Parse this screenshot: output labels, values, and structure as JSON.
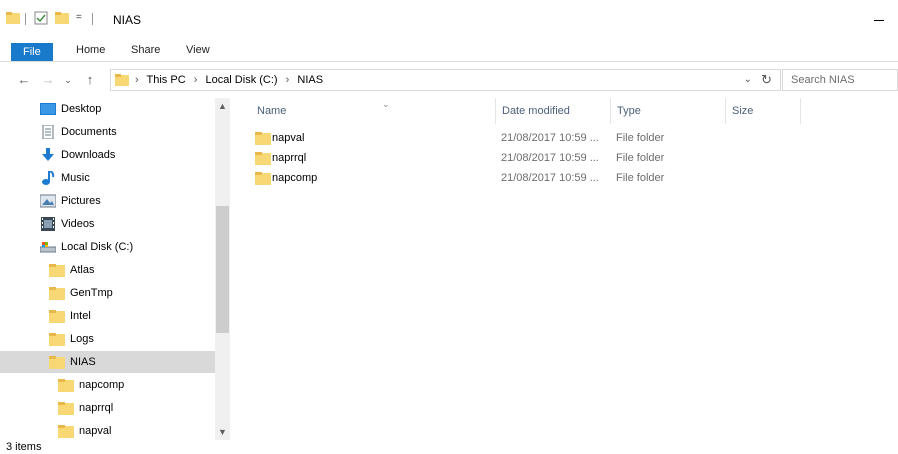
{
  "window": {
    "title": "NIAS"
  },
  "ribbon": {
    "tabs": [
      {
        "label": "File"
      },
      {
        "label": "Home"
      },
      {
        "label": "Share"
      },
      {
        "label": "View"
      }
    ]
  },
  "address": {
    "crumbs": [
      "This PC",
      "Local Disk (C:)",
      "NIAS"
    ],
    "separator": "›"
  },
  "search": {
    "placeholder": "Search NIAS"
  },
  "nav_tree": {
    "items": [
      {
        "label": "Desktop",
        "icon": "desktop-icon"
      },
      {
        "label": "Documents",
        "icon": "documents-icon"
      },
      {
        "label": "Downloads",
        "icon": "downloads-icon"
      },
      {
        "label": "Music",
        "icon": "music-icon"
      },
      {
        "label": "Pictures",
        "icon": "pictures-icon"
      },
      {
        "label": "Videos",
        "icon": "videos-icon"
      },
      {
        "label": "Local Disk (C:)",
        "icon": "drive-icon"
      },
      {
        "label": "Atlas",
        "icon": "folder-icon"
      },
      {
        "label": "GenTmp",
        "icon": "folder-icon"
      },
      {
        "label": "Intel",
        "icon": "folder-icon"
      },
      {
        "label": "Logs",
        "icon": "folder-icon"
      },
      {
        "label": "NIAS",
        "icon": "folder-icon",
        "selected": true
      },
      {
        "label": "napcomp",
        "icon": "folder-icon"
      },
      {
        "label": "naprrql",
        "icon": "folder-icon"
      },
      {
        "label": "napval",
        "icon": "folder-icon"
      }
    ]
  },
  "columns": {
    "name": "Name",
    "date": "Date modified",
    "type": "Type",
    "size": "Size"
  },
  "files": [
    {
      "name": "napval",
      "date": "21/08/2017 10:59 ...",
      "type": "File folder"
    },
    {
      "name": "naprrql",
      "date": "21/08/2017 10:59 ...",
      "type": "File folder"
    },
    {
      "name": "napcomp",
      "date": "21/08/2017 10:59 ...",
      "type": "File folder"
    }
  ],
  "status": {
    "item_count": "3 items"
  },
  "colors": {
    "accent": "#1979ca",
    "folder": "#f8d775",
    "folder_dark": "#e8b84a",
    "selection": "#d9d9d9",
    "header_text": "#4c607a"
  }
}
